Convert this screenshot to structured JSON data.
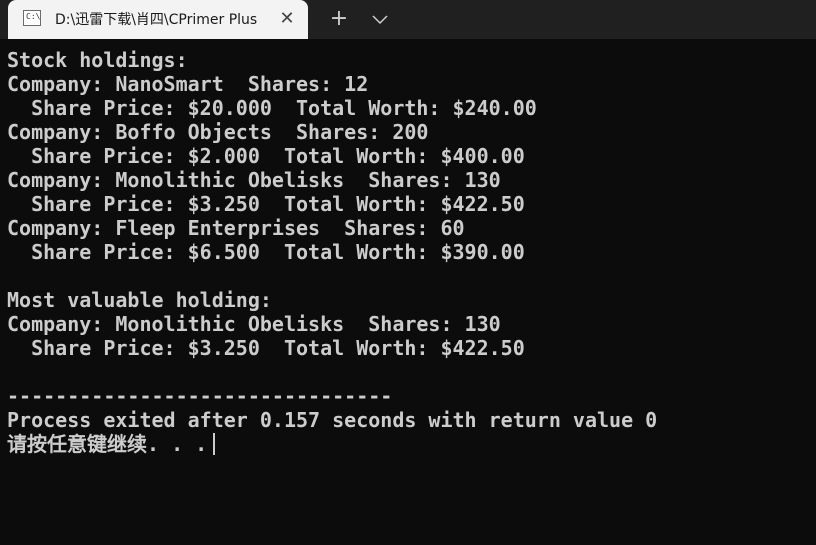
{
  "tab": {
    "icon": "console-app-icon",
    "icon_glyph": "C:\\",
    "title": "D:\\迅雷下载\\肖四\\CPrimer Plus",
    "close_icon": "close-icon"
  },
  "tabbar": {
    "new_tab_icon": "plus-icon",
    "new_tab_glyph": "+",
    "dropdown_icon": "chevron-down-icon"
  },
  "terminal": {
    "lines": [
      "Stock holdings:",
      "Company: NanoSmart  Shares: 12",
      "  Share Price: $20.000  Total Worth: $240.00",
      "Company: Boffo Objects  Shares: 200",
      "  Share Price: $2.000  Total Worth: $400.00",
      "Company: Monolithic Obelisks  Shares: 130",
      "  Share Price: $3.250  Total Worth: $422.50",
      "Company: Fleep Enterprises  Shares: 60",
      "  Share Price: $6.500  Total Worth: $390.00",
      "",
      "Most valuable holding:",
      "Company: Monolithic Obelisks  Shares: 130",
      "  Share Price: $3.250  Total Worth: $422.50",
      "",
      "--------------------------------",
      "Process exited after 0.157 seconds with return value 0",
      "请按任意键继续. . ."
    ],
    "colors": {
      "background": "#0c0c0c",
      "foreground": "#cccccc"
    }
  }
}
